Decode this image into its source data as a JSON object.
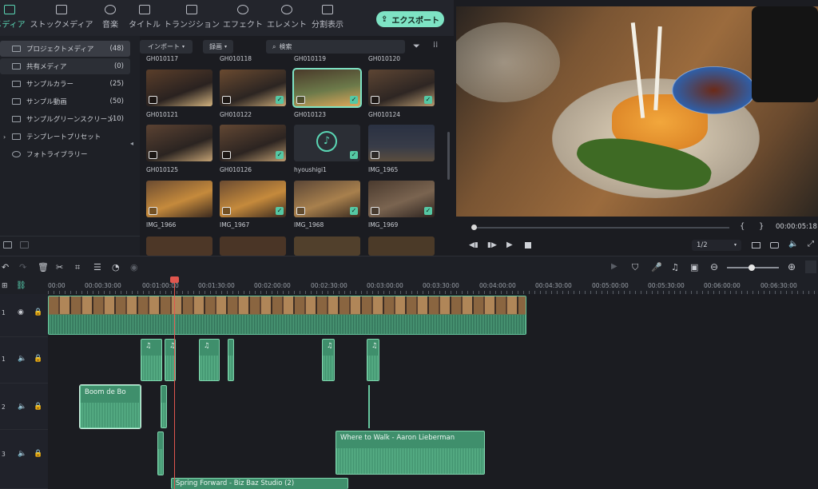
{
  "tabs": [
    {
      "label": "メディア",
      "active": true
    },
    {
      "label": "ストックメディア"
    },
    {
      "label": "音楽"
    },
    {
      "label": "タイトル"
    },
    {
      "label": "トランジション"
    },
    {
      "label": "エフェクト"
    },
    {
      "label": "エレメント"
    },
    {
      "label": "分割表示"
    }
  ],
  "export_label": "エクスポート",
  "sidebar": {
    "items": [
      {
        "label": "プロジェクトメディア",
        "count": "(48)"
      },
      {
        "label": "共有メディア",
        "count": "(0)"
      },
      {
        "label": "サンプルカラー",
        "count": "(25)"
      },
      {
        "label": "サンプル動画",
        "count": "(50)"
      },
      {
        "label": "サンプルグリーンスクリーン",
        "count": "(10)"
      },
      {
        "label": "テンプレートプリセット",
        "count": ""
      },
      {
        "label": "フォトライブラリー",
        "count": ""
      }
    ]
  },
  "media": {
    "import_label": "インポート",
    "record_label": "録画",
    "search_placeholder": "検索",
    "top_labels": [
      "GH010117",
      "GH010118",
      "GH010119",
      "GH010120"
    ],
    "rows": [
      [
        "GH010121",
        "GH010122",
        "GH010123",
        "GH010124"
      ],
      [
        "GH010125",
        "GH010126",
        "hyoushigi1",
        "IMG_1965"
      ],
      [
        "IMG_1966",
        "IMG_1967",
        "IMG_1968",
        "IMG_1969"
      ]
    ]
  },
  "preview": {
    "timecode": "00:00:05:18",
    "quality": "1/2",
    "bracket_in": "{",
    "bracket_out": "}"
  },
  "ruler": [
    "00:00",
    "00:00:30:00",
    "00:01:00:00",
    "00:01:30:00",
    "00:02:00:00",
    "00:02:30:00",
    "00:03:00:00",
    "00:03:30:00",
    "00:04:00:00",
    "00:04:30:00",
    "00:05:00:00",
    "00:05:30:00",
    "00:06:00:00",
    "00:06:30:00"
  ],
  "tracks": {
    "video1": "1",
    "audio1": "1",
    "audio2": "2",
    "audio3": "3"
  },
  "clips": {
    "boom": "Boom de Bo",
    "where": "Where to Walk - Aaron Lieberman",
    "spring": "Spring Forward - Biz Baz Studio (2)"
  },
  "colors": {
    "accent": "#7ee3c4",
    "playhead": "#e0564e",
    "audio_clip": "#3f8f6c"
  }
}
